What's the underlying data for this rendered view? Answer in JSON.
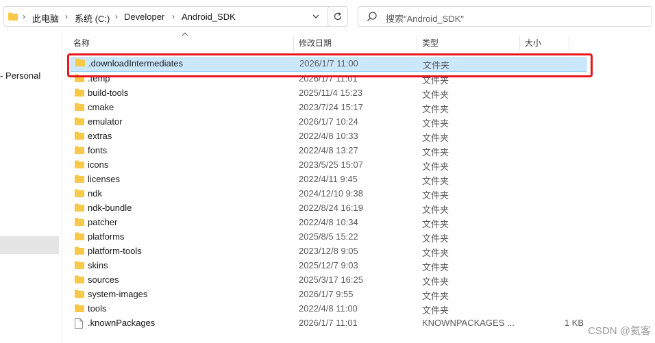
{
  "address": {
    "crumbs": [
      "此电脑",
      "系统 (C:)",
      "Developer",
      "Android_SDK"
    ]
  },
  "search": {
    "placeholder": "搜索\"Android_SDK\""
  },
  "nav": {
    "item_label": "- Personal"
  },
  "columns": {
    "name": "名称",
    "date": "修改日期",
    "type": "类型",
    "size": "大小"
  },
  "files": [
    {
      "name": ".downloadIntermediates",
      "date": "2026/1/7 11:00",
      "type": "文件夹",
      "size": "",
      "icon": "folder-icon",
      "selected": true
    },
    {
      "name": ".temp",
      "date": "2026/1/7 11:01",
      "type": "文件夹",
      "size": "",
      "icon": "folder-icon"
    },
    {
      "name": "build-tools",
      "date": "2025/11/4 15:23",
      "type": "文件夹",
      "size": "",
      "icon": "folder-icon"
    },
    {
      "name": "cmake",
      "date": "2023/7/24 15:17",
      "type": "文件夹",
      "size": "",
      "icon": "folder-icon"
    },
    {
      "name": "emulator",
      "date": "2026/1/7 10:24",
      "type": "文件夹",
      "size": "",
      "icon": "folder-icon"
    },
    {
      "name": "extras",
      "date": "2022/4/8 10:33",
      "type": "文件夹",
      "size": "",
      "icon": "folder-icon"
    },
    {
      "name": "fonts",
      "date": "2022/4/8 13:27",
      "type": "文件夹",
      "size": "",
      "icon": "folder-icon"
    },
    {
      "name": "icons",
      "date": "2023/5/25 15:07",
      "type": "文件夹",
      "size": "",
      "icon": "folder-icon"
    },
    {
      "name": "licenses",
      "date": "2022/4/11 9:45",
      "type": "文件夹",
      "size": "",
      "icon": "folder-icon"
    },
    {
      "name": "ndk",
      "date": "2024/12/10 9:38",
      "type": "文件夹",
      "size": "",
      "icon": "folder-icon"
    },
    {
      "name": "ndk-bundle",
      "date": "2022/8/24 16:19",
      "type": "文件夹",
      "size": "",
      "icon": "folder-icon"
    },
    {
      "name": "patcher",
      "date": "2022/4/8 10:34",
      "type": "文件夹",
      "size": "",
      "icon": "folder-icon"
    },
    {
      "name": "platforms",
      "date": "2025/8/5 15:22",
      "type": "文件夹",
      "size": "",
      "icon": "folder-icon"
    },
    {
      "name": "platform-tools",
      "date": "2023/12/8 9:05",
      "type": "文件夹",
      "size": "",
      "icon": "folder-icon"
    },
    {
      "name": "skins",
      "date": "2025/12/7 9:03",
      "type": "文件夹",
      "size": "",
      "icon": "folder-icon"
    },
    {
      "name": "sources",
      "date": "2025/3/17 16:25",
      "type": "文件夹",
      "size": "",
      "icon": "folder-icon"
    },
    {
      "name": "system-images",
      "date": "2026/1/7 9:55",
      "type": "文件夹",
      "size": "",
      "icon": "folder-icon"
    },
    {
      "name": "tools",
      "date": "2022/4/8 11:00",
      "type": "文件夹",
      "size": "",
      "icon": "folder-icon"
    },
    {
      "name": ".knownPackages",
      "date": "2026/1/7 11:01",
      "type": "KNOWNPACKAGES ...",
      "size": "1 KB",
      "icon": "file-icon"
    }
  ],
  "watermark": "CSDN @氦客",
  "colors": {
    "folder": "#f7c948",
    "selection": "#cce8ff",
    "highlight_box": "#e8141b"
  }
}
